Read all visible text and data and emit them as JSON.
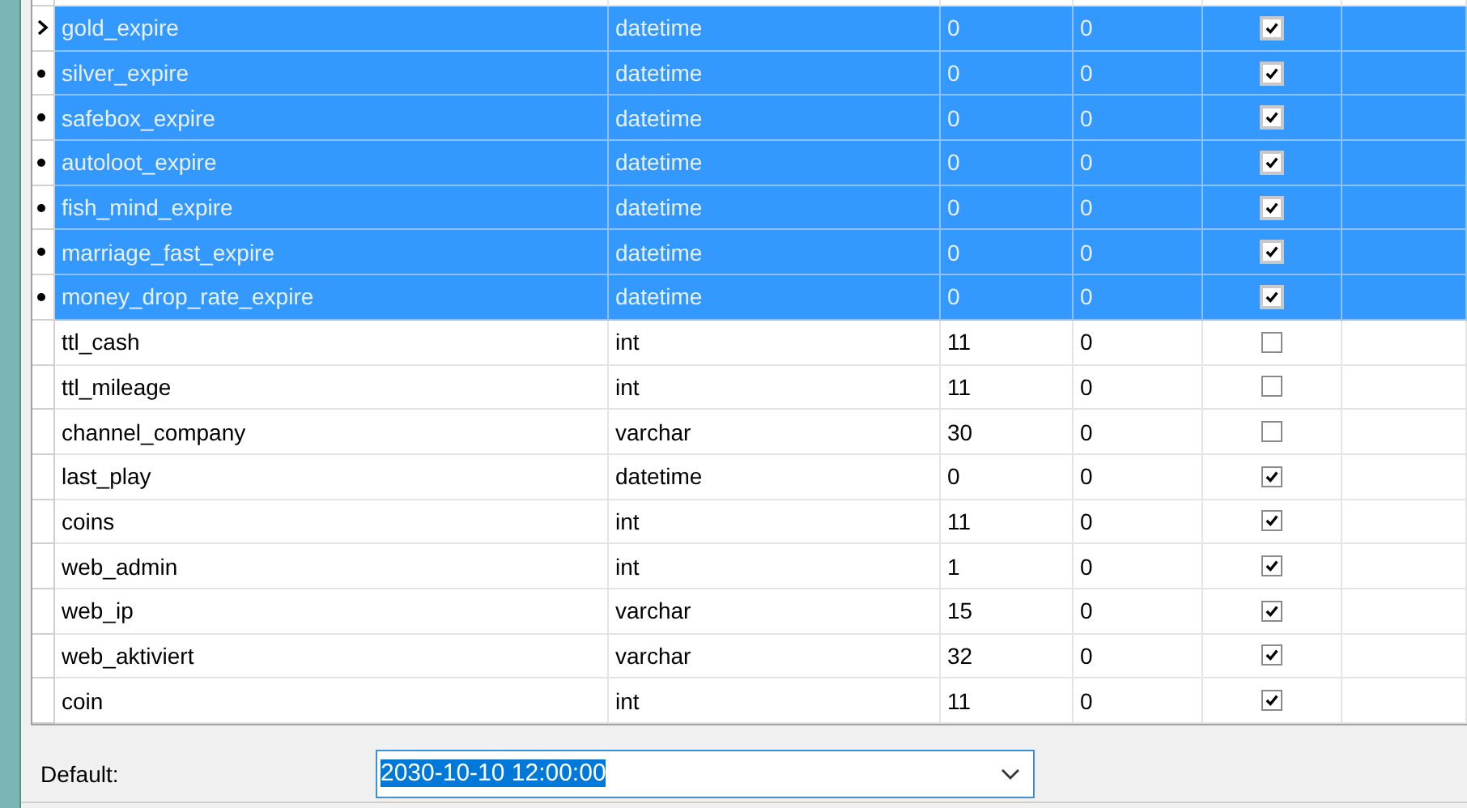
{
  "fields": [
    {
      "name": "gold_expire",
      "type": "datetime",
      "length": "0",
      "decimals": "0",
      "not_null": true,
      "selected": true,
      "current": true
    },
    {
      "name": "silver_expire",
      "type": "datetime",
      "length": "0",
      "decimals": "0",
      "not_null": true,
      "selected": true,
      "current": false
    },
    {
      "name": "safebox_expire",
      "type": "datetime",
      "length": "0",
      "decimals": "0",
      "not_null": true,
      "selected": true,
      "current": false
    },
    {
      "name": "autoloot_expire",
      "type": "datetime",
      "length": "0",
      "decimals": "0",
      "not_null": true,
      "selected": true,
      "current": false
    },
    {
      "name": "fish_mind_expire",
      "type": "datetime",
      "length": "0",
      "decimals": "0",
      "not_null": true,
      "selected": true,
      "current": false
    },
    {
      "name": "marriage_fast_expire",
      "type": "datetime",
      "length": "0",
      "decimals": "0",
      "not_null": true,
      "selected": true,
      "current": false
    },
    {
      "name": "money_drop_rate_expire",
      "type": "datetime",
      "length": "0",
      "decimals": "0",
      "not_null": true,
      "selected": true,
      "current": false
    },
    {
      "name": "ttl_cash",
      "type": "int",
      "length": "11",
      "decimals": "0",
      "not_null": false,
      "selected": false,
      "current": false
    },
    {
      "name": "ttl_mileage",
      "type": "int",
      "length": "11",
      "decimals": "0",
      "not_null": false,
      "selected": false,
      "current": false
    },
    {
      "name": "channel_company",
      "type": "varchar",
      "length": "30",
      "decimals": "0",
      "not_null": false,
      "selected": false,
      "current": false
    },
    {
      "name": "last_play",
      "type": "datetime",
      "length": "0",
      "decimals": "0",
      "not_null": true,
      "selected": false,
      "current": false
    },
    {
      "name": "coins",
      "type": "int",
      "length": "11",
      "decimals": "0",
      "not_null": true,
      "selected": false,
      "current": false
    },
    {
      "name": "web_admin",
      "type": "int",
      "length": "1",
      "decimals": "0",
      "not_null": true,
      "selected": false,
      "current": false
    },
    {
      "name": "web_ip",
      "type": "varchar",
      "length": "15",
      "decimals": "0",
      "not_null": true,
      "selected": false,
      "current": false
    },
    {
      "name": "web_aktiviert",
      "type": "varchar",
      "length": "32",
      "decimals": "0",
      "not_null": true,
      "selected": false,
      "current": false
    },
    {
      "name": "coin",
      "type": "int",
      "length": "11",
      "decimals": "0",
      "not_null": true,
      "selected": false,
      "current": false
    }
  ],
  "default_field": {
    "label": "Default:",
    "value": "2030-10-10 12:00:00"
  }
}
